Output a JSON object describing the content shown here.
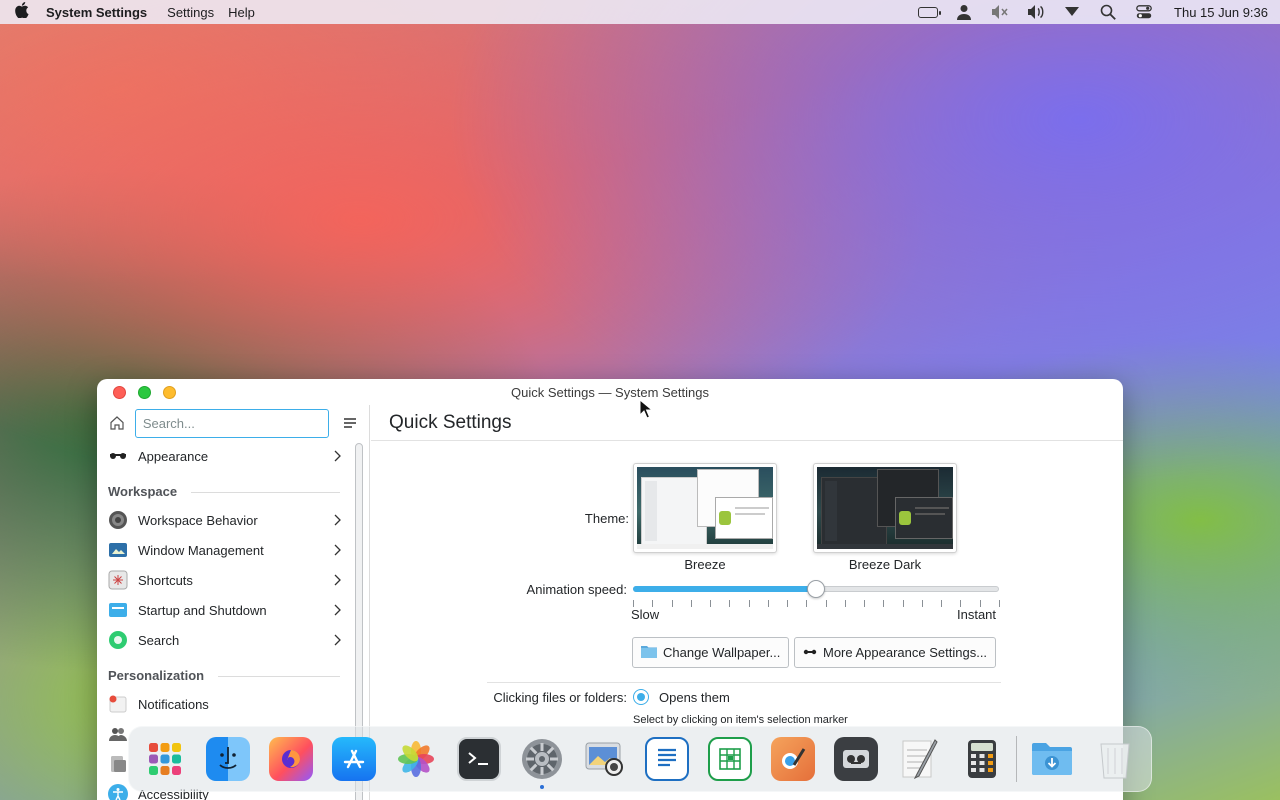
{
  "menubar": {
    "app_name": "System Settings",
    "menus": [
      "Settings",
      "Help"
    ],
    "clock": "Thu 15 Jun 9:36",
    "icons": [
      "apple-icon",
      "battery-icon",
      "user-icon",
      "mute-icon",
      "volume-icon",
      "network-icon",
      "search-icon",
      "control-center-icon"
    ]
  },
  "window": {
    "title": "Quick Settings — System Settings",
    "sidebar": {
      "search_placeholder": "Search...",
      "items": [
        {
          "label": "Appearance",
          "icon": "appearance-icon",
          "chevron": true
        },
        {
          "section": "Workspace"
        },
        {
          "label": "Workspace Behavior",
          "icon": "workspace-behavior-icon",
          "chevron": true
        },
        {
          "label": "Window Management",
          "icon": "window-management-icon",
          "chevron": true
        },
        {
          "label": "Shortcuts",
          "icon": "shortcuts-icon",
          "chevron": true
        },
        {
          "label": "Startup and Shutdown",
          "icon": "startup-icon",
          "chevron": true
        },
        {
          "label": "Search",
          "icon": "search-icon",
          "chevron": true
        },
        {
          "section": "Personalization"
        },
        {
          "label": "Notifications",
          "icon": "notifications-icon",
          "chevron": false
        },
        {
          "label": "",
          "icon": "users-icon",
          "chevron": false
        },
        {
          "label": "",
          "icon": "regional-icon",
          "chevron": false
        },
        {
          "label": "Accessibility",
          "icon": "accessibility-icon",
          "chevron": false
        }
      ]
    },
    "content": {
      "page_title": "Quick Settings",
      "theme_label": "Theme:",
      "themes": [
        {
          "name": "Breeze",
          "style": "light"
        },
        {
          "name": "Breeze Dark",
          "style": "dark"
        }
      ],
      "animation_label": "Animation speed:",
      "animation_value": 0.5,
      "animation_ticks": 20,
      "slow_label": "Slow",
      "instant_label": "Instant",
      "change_wallpaper": "Change Wallpaper...",
      "more_appearance": "More Appearance Settings...",
      "clicking_label": "Clicking files or folders:",
      "clicking_option": "Opens them",
      "clicking_hint": "Select by clicking on item's selection marker"
    }
  },
  "dock": {
    "apps": [
      "app-launcher-icon",
      "finder-icon",
      "firefox-icon",
      "app-store-icon",
      "photos-icon",
      "terminal-icon",
      "system-settings-icon",
      "screenshot-icon",
      "writer-icon",
      "calc-spreadsheet-icon",
      "paint-icon",
      "tape-recorder-icon",
      "text-editor-icon",
      "calculator-icon",
      "downloads-folder-icon",
      "trash-icon"
    ],
    "running": "system-settings-icon"
  },
  "colors": {
    "accent": "#3daee9",
    "close": "#fe5f57",
    "maximize": "#2bc840",
    "minimize": "#febc2e"
  }
}
